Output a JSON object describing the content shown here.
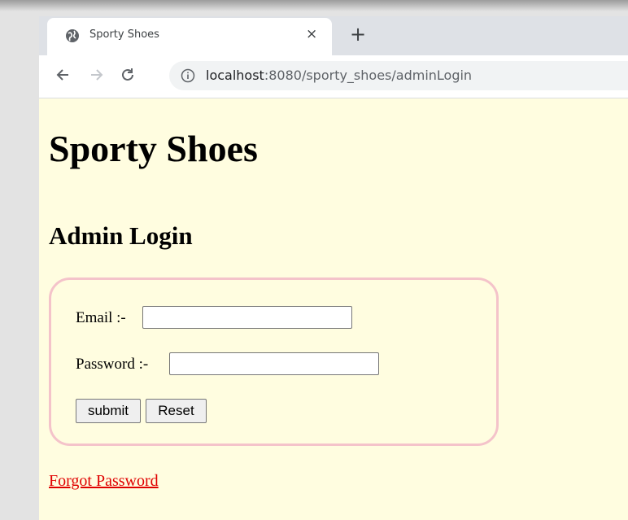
{
  "browser": {
    "tab_title": "Sporty Shoes",
    "tab_close": "×",
    "new_tab": "+",
    "url_host": "localhost",
    "url_path": ":8080/sporty_shoes/adminLogin"
  },
  "page": {
    "title": "Sporty Shoes",
    "section_title": "Admin Login",
    "form": {
      "email_label": "Email :-",
      "email_value": "",
      "password_label": "Password :-",
      "password_value": "",
      "submit_label": "submit",
      "reset_label": "Reset",
      "border_color": "#f4c3ca"
    },
    "forgot_link": "Forgot Password"
  },
  "colors": {
    "page_background": "#fffde0",
    "link": "#e00000",
    "tabstrip": "#dee1e6"
  },
  "icons": {
    "favicon": "globe-icon",
    "back": "arrow-left-icon",
    "forward": "arrow-right-icon",
    "reload": "reload-icon",
    "info": "info-icon"
  }
}
